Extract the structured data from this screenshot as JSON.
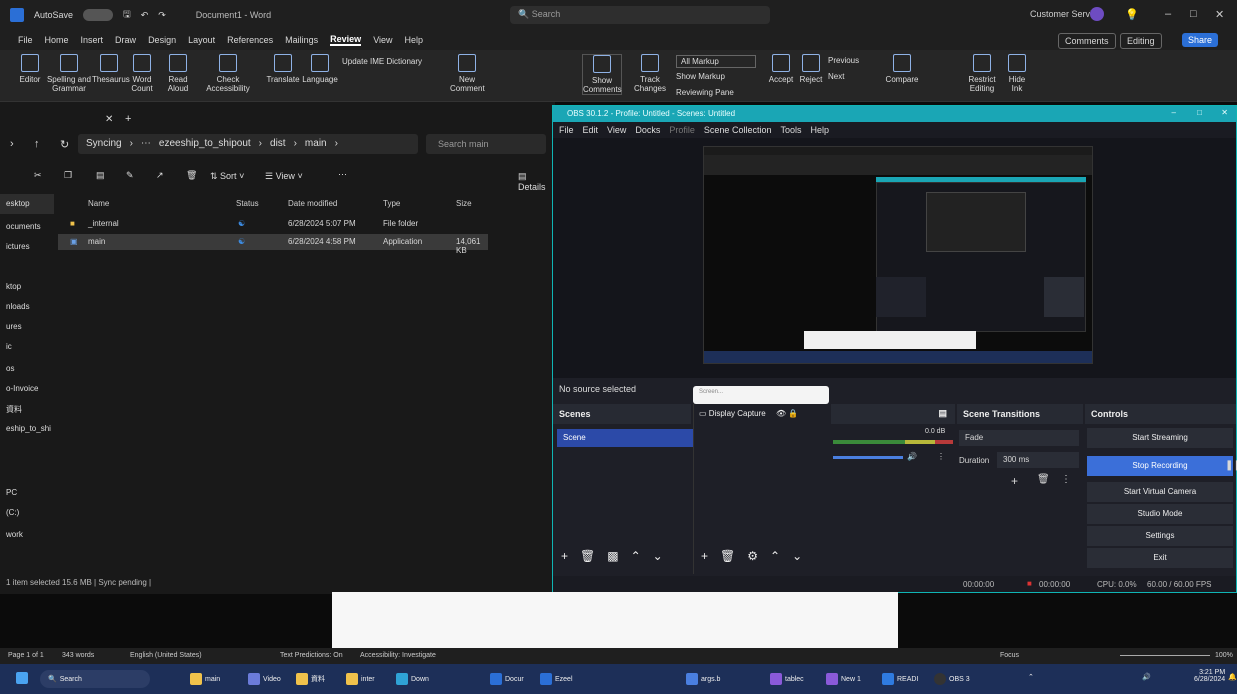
{
  "word": {
    "title": "Document1 - Word",
    "autosave": "AutoSave",
    "search_placeholder": "Search",
    "user": "Customer Service",
    "menu": [
      "File",
      "Home",
      "Insert",
      "Draw",
      "Design",
      "Layout",
      "References",
      "Mailings",
      "Review",
      "View",
      "Help"
    ],
    "active_menu": "Review",
    "comments_label": "Comments",
    "editing_label": "Editing",
    "share_label": "Share",
    "ribbon": {
      "editor": "Editor",
      "spelling": "Spelling and Grammar",
      "thesaurus": "Thesaurus",
      "word_count": "Word Count",
      "read_aloud": "Read Aloud",
      "check_accessibility": "Check Accessibility",
      "translate": "Translate",
      "language": "Language",
      "update_ime": "Update IME Dictionary",
      "new_comment": "New Comment",
      "show_comments": "Show Comments",
      "track_changes": "Track Changes",
      "all_markup": "All Markup",
      "show_markup": "Show Markup",
      "reviewing_pane": "Reviewing Pane",
      "accept": "Accept",
      "reject": "Reject",
      "previous": "Previous",
      "next": "Next",
      "compare": "Compare",
      "restrict_editing": "Restrict Editing",
      "hide_ink": "Hide Ink"
    },
    "status": {
      "page": "Page 1 of 1",
      "words": "343 words",
      "language": "English (United States)",
      "text_predictions": "Text Predictions: On",
      "accessibility": "Accessibility: Investigate",
      "focus": "Focus",
      "zoom": "100%"
    }
  },
  "explorer": {
    "breadcrumb": [
      "Syncing",
      "ezeeship_to_shipout",
      "dist",
      "main"
    ],
    "search_placeholder": "Search main",
    "toolbar": {
      "sort": "Sort",
      "view": "View",
      "details": "Details"
    },
    "columns": [
      "Name",
      "Status",
      "Date modified",
      "Type",
      "Size"
    ],
    "rows": [
      {
        "name": "_internal",
        "date": "6/28/2024 5:07 PM",
        "type": "File folder",
        "size": ""
      },
      {
        "name": "main",
        "date": "6/28/2024 4:58 PM",
        "type": "Application",
        "size": "14,061 KB"
      }
    ],
    "sidebar": [
      "esktop",
      "ocuments",
      "ictures",
      "ktop",
      "nloads",
      "ures",
      "ic",
      "os",
      "o-Invoice",
      "資料",
      "eship_to_shi",
      "PC",
      "(C:)",
      "work"
    ],
    "status": "1 item selected  15.6 MB  |  Sync pending  |"
  },
  "obs": {
    "title": "OBS 30.1.2 - Profile: Untitled - Scenes: Untitled",
    "menu": [
      "File",
      "Edit",
      "View",
      "Docks",
      "Profile",
      "Scene Collection",
      "Tools",
      "Help"
    ],
    "no_source": "No source selected",
    "search_placeholder": "Screen...",
    "scenes_header": "Scenes",
    "scene_item": "Scene",
    "source_item": "Display Capture",
    "audio_level": "0.0 dB",
    "transitions_header": "Scene Transitions",
    "transition": "Fade",
    "duration_label": "Duration",
    "duration_value": "300 ms",
    "controls_header": "Controls",
    "controls": [
      "Start Streaming",
      "Stop Recording",
      "Start Virtual Camera",
      "Studio Mode",
      "Settings",
      "Exit"
    ],
    "status": {
      "stream_time": "00:00:00",
      "rec_time": "00:00:00",
      "cpu": "CPU: 0.0%",
      "fps": "60.00 / 60.00 FPS"
    }
  },
  "taskbar": {
    "search": "Search",
    "items": [
      "main",
      "Video",
      "資料",
      "inter",
      "Down",
      "Docur",
      "Ezeel",
      "args.b",
      "tablec",
      "New 1",
      "READI",
      "OBS 3"
    ],
    "time": "3:21 PM",
    "date": "6/28/2024"
  }
}
